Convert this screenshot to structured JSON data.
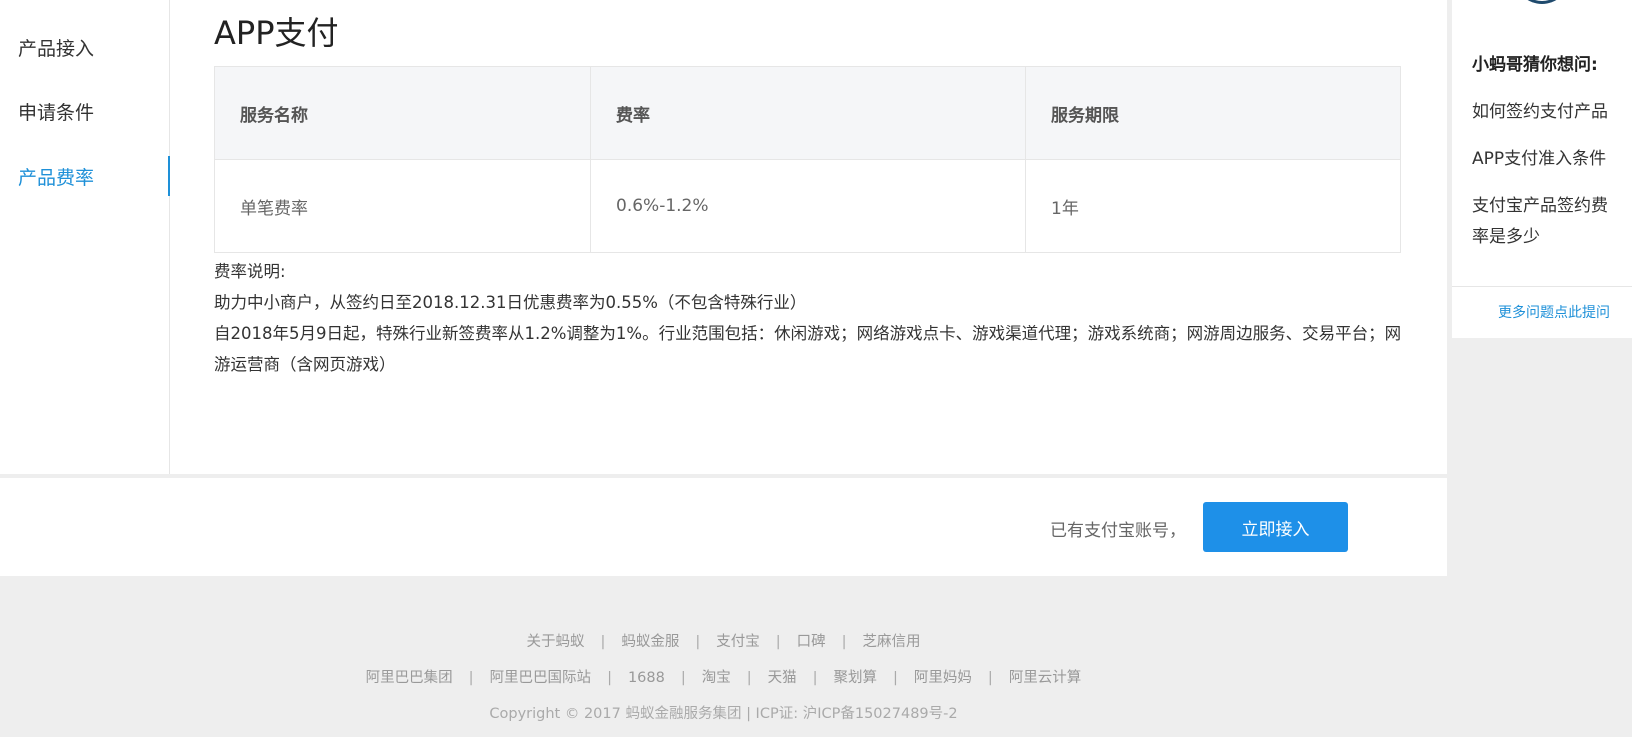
{
  "left_nav": {
    "items": [
      {
        "label": "产品接入",
        "active": false
      },
      {
        "label": "申请条件",
        "active": false
      },
      {
        "label": "产品费率",
        "active": true
      }
    ]
  },
  "page_title": "APP支付",
  "rate_table": {
    "headers": [
      "服务名称",
      "费率",
      "服务期限"
    ],
    "rows": [
      [
        "单笔费率",
        "0.6%-1.2%",
        "1年"
      ]
    ]
  },
  "notes": {
    "heading": "费率说明:",
    "line1": "助力中小商户，从签约日至2018.12.31日优惠费率为0.55%（不包含特殊行业）",
    "line2": "自2018年5月9日起，特殊行业新签费率从1.2%调整为1%。行业范围包括：休闲游戏；网络游戏点卡、游戏渠道代理；游戏系统商；网游周边服务、交易平台；网游运营商（含网页游戏）"
  },
  "action_bar": {
    "account_text": "已有支付宝账号，",
    "join_button": "立即接入"
  },
  "right_panel": {
    "title": "小蚂哥猜你想问:",
    "links": [
      "如何签约支付产品",
      "APP支付准入条件",
      "支付宝产品签约费率是多少"
    ],
    "more": "更多问题点此提问"
  },
  "footer": {
    "row1": [
      "关于蚂蚁",
      "蚂蚁金服",
      "支付宝",
      "口碑",
      "芝麻信用"
    ],
    "row2": [
      "阿里巴巴集团",
      "阿里巴巴国际站",
      "1688",
      "淘宝",
      "天猫",
      "聚划算",
      "阿里妈妈",
      "阿里云计算"
    ],
    "copyright": "Copyright © 2017 蚂蚁金融服务集团 | ICP证: 沪ICP备15027489号-2"
  },
  "colors": {
    "accent": "#1e90d8",
    "button": "#1e90e8",
    "page_bg": "#eeeeee"
  }
}
